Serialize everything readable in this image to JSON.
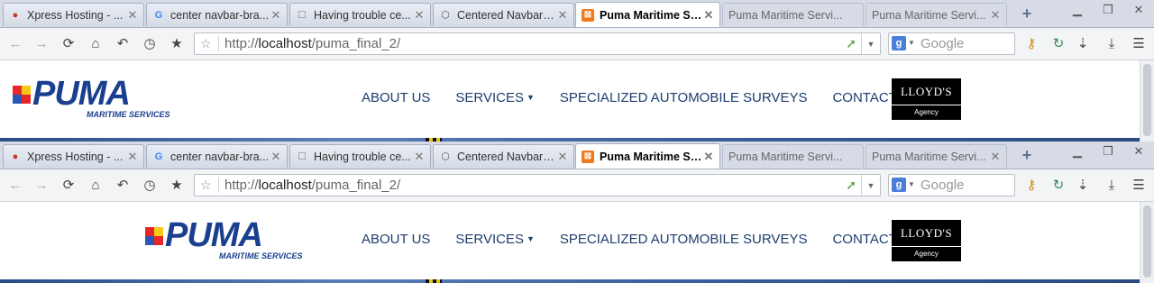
{
  "shots": [
    {
      "tabs": [
        {
          "label": "Xpress Hosting - ...",
          "icon": "xpress-favicon",
          "state": "normal"
        },
        {
          "label": "center navbar-bra...",
          "icon": "google-favicon",
          "state": "normal"
        },
        {
          "label": "Having trouble ce...",
          "icon": "stackoverflow-favicon",
          "state": "normal"
        },
        {
          "label": "Centered Navbar I...",
          "icon": "codepen-favicon",
          "state": "normal"
        },
        {
          "label": "Puma Maritime Se...",
          "icon": "xampp-favicon",
          "state": "active"
        },
        {
          "label": "Puma Maritime Servi...",
          "icon": "",
          "state": "dim"
        },
        {
          "label": "Puma Maritime Servi...",
          "icon": "",
          "state": "dim"
        }
      ],
      "url_prefix": "http://",
      "url_host": "localhost",
      "url_path": "/puma_final_2/",
      "search_placeholder": "Google",
      "logo": {
        "word": "PUMA",
        "sub": "MARITIME SERVICES"
      },
      "nav": {
        "about": "ABOUT US",
        "services": "SERVICES",
        "surveys": "SPECIALIZED AUTOMOBILE SURVEYS",
        "contact": "CONTACT US"
      },
      "lloyds": {
        "name": "LLOYD'S",
        "agency": "Agency"
      }
    },
    {
      "tabs": [
        {
          "label": "Xpress Hosting - ...",
          "icon": "xpress-favicon",
          "state": "normal"
        },
        {
          "label": "center navbar-bra...",
          "icon": "google-favicon",
          "state": "normal"
        },
        {
          "label": "Having trouble ce...",
          "icon": "stackoverflow-favicon",
          "state": "normal"
        },
        {
          "label": "Centered Navbar I...",
          "icon": "codepen-favicon",
          "state": "normal"
        },
        {
          "label": "Puma Maritime Se...",
          "icon": "xampp-favicon",
          "state": "active"
        },
        {
          "label": "Puma Maritime Servi...",
          "icon": "",
          "state": "dim"
        },
        {
          "label": "Puma Maritime Servi...",
          "icon": "",
          "state": "dim"
        }
      ],
      "url_prefix": "http://",
      "url_host": "localhost",
      "url_path": "/puma_final_2/",
      "search_placeholder": "Google",
      "logo": {
        "word": "PUMA",
        "sub": "MARITIME SERVICES"
      },
      "nav": {
        "about": "ABOUT US",
        "services": "SERVICES",
        "surveys": "SPECIALIZED AUTOMOBILE SURVEYS",
        "contact": "CONTACT US"
      },
      "lloyds": {
        "name": "LLOYD'S",
        "agency": "Agency"
      }
    }
  ],
  "colors": {
    "brand_blue": "#1a3f8f",
    "nav_text": "#1c3d6e",
    "lloyds_bg": "#000000"
  }
}
